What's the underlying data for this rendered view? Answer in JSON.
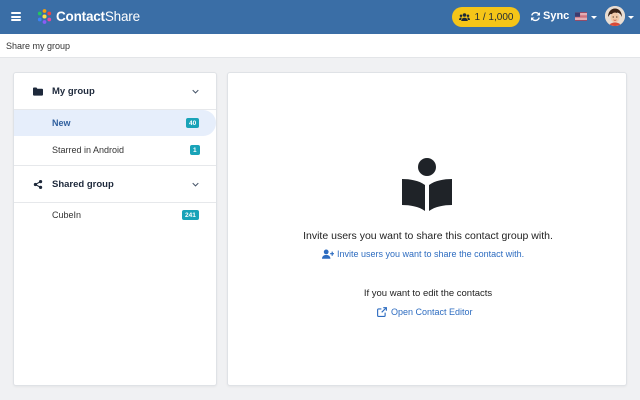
{
  "header": {
    "app_name_bold": "Contact",
    "app_name_light": "Share",
    "contact_count": "1 / 1,000",
    "sync_label": "Sync",
    "language_flag": "flag-us-icon",
    "brand_color": "#3a6ea6",
    "count_pill_color": "#f5c518"
  },
  "breadcrumb": {
    "current": "Share my group"
  },
  "sidebar": {
    "groups": [
      {
        "label": "My group",
        "icon": "folder-icon",
        "items": [
          {
            "label": "New",
            "count": "40",
            "active": true
          },
          {
            "label": "Starred in Android",
            "count": "1",
            "active": false
          }
        ]
      },
      {
        "label": "Shared group",
        "icon": "share-icon",
        "items": [
          {
            "label": "CubeIn",
            "count": "241",
            "active": false
          }
        ]
      }
    ],
    "badge_color": "#19a3b8"
  },
  "main": {
    "illustration_icon": "reading-person-icon",
    "invite_heading": "Invite users you want to share this contact group with.",
    "invite_link": "Invite users you want to share the contact with.",
    "edit_heading": "If you want to edit the contacts",
    "edit_link": "Open Contact Editor",
    "link_color": "#2d6cc0"
  }
}
